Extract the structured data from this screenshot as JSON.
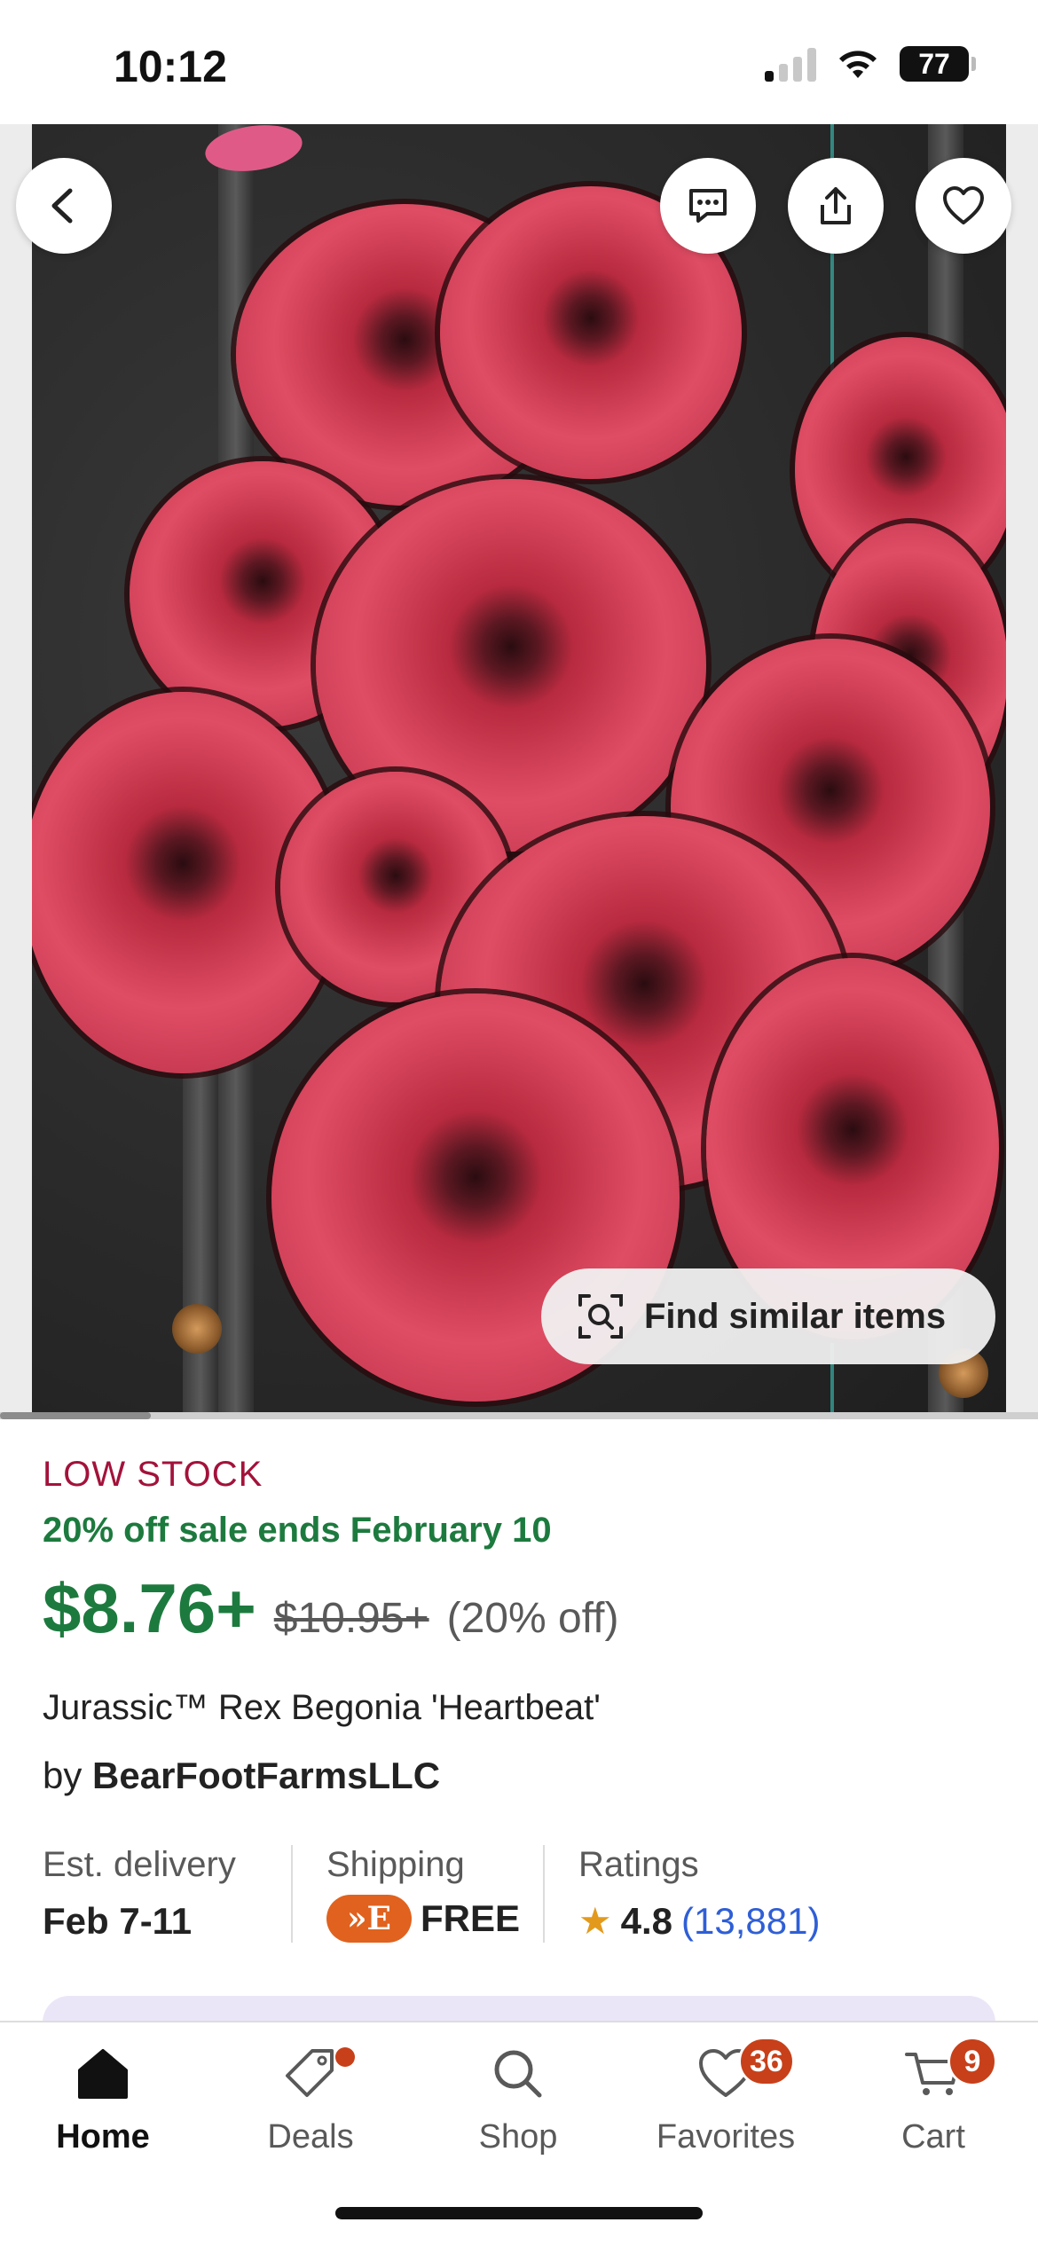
{
  "status_bar": {
    "time": "10:12",
    "battery": "77",
    "icons": [
      "signal-icon",
      "wifi-icon",
      "battery-icon"
    ]
  },
  "hero": {
    "image_subject": "red rex begonia plant",
    "find_similar_label": "Find similar items",
    "buttons": [
      "back-icon",
      "message-icon",
      "share-icon",
      "heart-icon"
    ]
  },
  "product": {
    "stock_status": "LOW STOCK",
    "sale_note": "20% off sale ends February 10",
    "price": "$8.76+",
    "original_price": "$10.95+",
    "discount": "(20% off)",
    "title": "Jurassic™ Rex Begonia 'Heartbeat'",
    "by_prefix": "by",
    "shop_name": "BearFootFarmsLLC"
  },
  "details": {
    "delivery_label": "Est. delivery",
    "delivery_value": "Feb 7-11",
    "shipping_label": "Shipping",
    "shipping_badge": "»E",
    "shipping_value": "FREE",
    "ratings_label": "Ratings",
    "rating_value": "4.8",
    "rating_count": "(13,881)"
  },
  "bottom_nav": {
    "items": [
      {
        "label": "Home",
        "icon": "home-icon",
        "active": true
      },
      {
        "label": "Deals",
        "icon": "tag-icon",
        "has_dot": true
      },
      {
        "label": "Shop",
        "icon": "search-icon"
      },
      {
        "label": "Favorites",
        "icon": "heart-icon",
        "badge": "36"
      },
      {
        "label": "Cart",
        "icon": "cart-icon",
        "badge": "9"
      }
    ]
  },
  "colors": {
    "sale_green": "#1d7a3e",
    "low_stock_red": "#a3123a",
    "badge_orange": "#c7401a",
    "link_blue": "#2f5fd6",
    "star": "#e39a1c"
  }
}
